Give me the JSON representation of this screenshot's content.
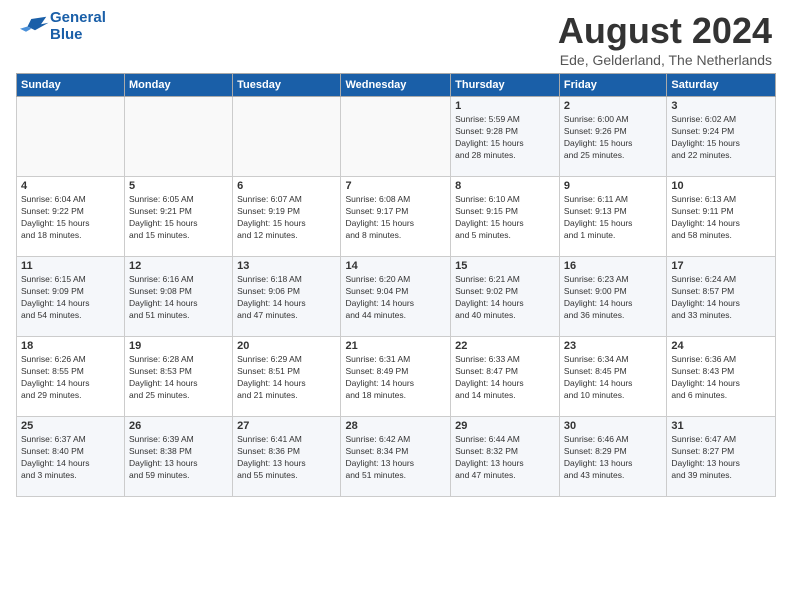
{
  "header": {
    "logo_line1": "General",
    "logo_line2": "Blue",
    "title": "August 2024",
    "location": "Ede, Gelderland, The Netherlands"
  },
  "calendar": {
    "days_of_week": [
      "Sunday",
      "Monday",
      "Tuesday",
      "Wednesday",
      "Thursday",
      "Friday",
      "Saturday"
    ],
    "weeks": [
      [
        {
          "day": "",
          "info": ""
        },
        {
          "day": "",
          "info": ""
        },
        {
          "day": "",
          "info": ""
        },
        {
          "day": "",
          "info": ""
        },
        {
          "day": "1",
          "info": "Sunrise: 5:59 AM\nSunset: 9:28 PM\nDaylight: 15 hours\nand 28 minutes."
        },
        {
          "day": "2",
          "info": "Sunrise: 6:00 AM\nSunset: 9:26 PM\nDaylight: 15 hours\nand 25 minutes."
        },
        {
          "day": "3",
          "info": "Sunrise: 6:02 AM\nSunset: 9:24 PM\nDaylight: 15 hours\nand 22 minutes."
        }
      ],
      [
        {
          "day": "4",
          "info": "Sunrise: 6:04 AM\nSunset: 9:22 PM\nDaylight: 15 hours\nand 18 minutes."
        },
        {
          "day": "5",
          "info": "Sunrise: 6:05 AM\nSunset: 9:21 PM\nDaylight: 15 hours\nand 15 minutes."
        },
        {
          "day": "6",
          "info": "Sunrise: 6:07 AM\nSunset: 9:19 PM\nDaylight: 15 hours\nand 12 minutes."
        },
        {
          "day": "7",
          "info": "Sunrise: 6:08 AM\nSunset: 9:17 PM\nDaylight: 15 hours\nand 8 minutes."
        },
        {
          "day": "8",
          "info": "Sunrise: 6:10 AM\nSunset: 9:15 PM\nDaylight: 15 hours\nand 5 minutes."
        },
        {
          "day": "9",
          "info": "Sunrise: 6:11 AM\nSunset: 9:13 PM\nDaylight: 15 hours\nand 1 minute."
        },
        {
          "day": "10",
          "info": "Sunrise: 6:13 AM\nSunset: 9:11 PM\nDaylight: 14 hours\nand 58 minutes."
        }
      ],
      [
        {
          "day": "11",
          "info": "Sunrise: 6:15 AM\nSunset: 9:09 PM\nDaylight: 14 hours\nand 54 minutes."
        },
        {
          "day": "12",
          "info": "Sunrise: 6:16 AM\nSunset: 9:08 PM\nDaylight: 14 hours\nand 51 minutes."
        },
        {
          "day": "13",
          "info": "Sunrise: 6:18 AM\nSunset: 9:06 PM\nDaylight: 14 hours\nand 47 minutes."
        },
        {
          "day": "14",
          "info": "Sunrise: 6:20 AM\nSunset: 9:04 PM\nDaylight: 14 hours\nand 44 minutes."
        },
        {
          "day": "15",
          "info": "Sunrise: 6:21 AM\nSunset: 9:02 PM\nDaylight: 14 hours\nand 40 minutes."
        },
        {
          "day": "16",
          "info": "Sunrise: 6:23 AM\nSunset: 9:00 PM\nDaylight: 14 hours\nand 36 minutes."
        },
        {
          "day": "17",
          "info": "Sunrise: 6:24 AM\nSunset: 8:57 PM\nDaylight: 14 hours\nand 33 minutes."
        }
      ],
      [
        {
          "day": "18",
          "info": "Sunrise: 6:26 AM\nSunset: 8:55 PM\nDaylight: 14 hours\nand 29 minutes."
        },
        {
          "day": "19",
          "info": "Sunrise: 6:28 AM\nSunset: 8:53 PM\nDaylight: 14 hours\nand 25 minutes."
        },
        {
          "day": "20",
          "info": "Sunrise: 6:29 AM\nSunset: 8:51 PM\nDaylight: 14 hours\nand 21 minutes."
        },
        {
          "day": "21",
          "info": "Sunrise: 6:31 AM\nSunset: 8:49 PM\nDaylight: 14 hours\nand 18 minutes."
        },
        {
          "day": "22",
          "info": "Sunrise: 6:33 AM\nSunset: 8:47 PM\nDaylight: 14 hours\nand 14 minutes."
        },
        {
          "day": "23",
          "info": "Sunrise: 6:34 AM\nSunset: 8:45 PM\nDaylight: 14 hours\nand 10 minutes."
        },
        {
          "day": "24",
          "info": "Sunrise: 6:36 AM\nSunset: 8:43 PM\nDaylight: 14 hours\nand 6 minutes."
        }
      ],
      [
        {
          "day": "25",
          "info": "Sunrise: 6:37 AM\nSunset: 8:40 PM\nDaylight: 14 hours\nand 3 minutes."
        },
        {
          "day": "26",
          "info": "Sunrise: 6:39 AM\nSunset: 8:38 PM\nDaylight: 13 hours\nand 59 minutes."
        },
        {
          "day": "27",
          "info": "Sunrise: 6:41 AM\nSunset: 8:36 PM\nDaylight: 13 hours\nand 55 minutes."
        },
        {
          "day": "28",
          "info": "Sunrise: 6:42 AM\nSunset: 8:34 PM\nDaylight: 13 hours\nand 51 minutes."
        },
        {
          "day": "29",
          "info": "Sunrise: 6:44 AM\nSunset: 8:32 PM\nDaylight: 13 hours\nand 47 minutes."
        },
        {
          "day": "30",
          "info": "Sunrise: 6:46 AM\nSunset: 8:29 PM\nDaylight: 13 hours\nand 43 minutes."
        },
        {
          "day": "31",
          "info": "Sunrise: 6:47 AM\nSunset: 8:27 PM\nDaylight: 13 hours\nand 39 minutes."
        }
      ]
    ]
  }
}
